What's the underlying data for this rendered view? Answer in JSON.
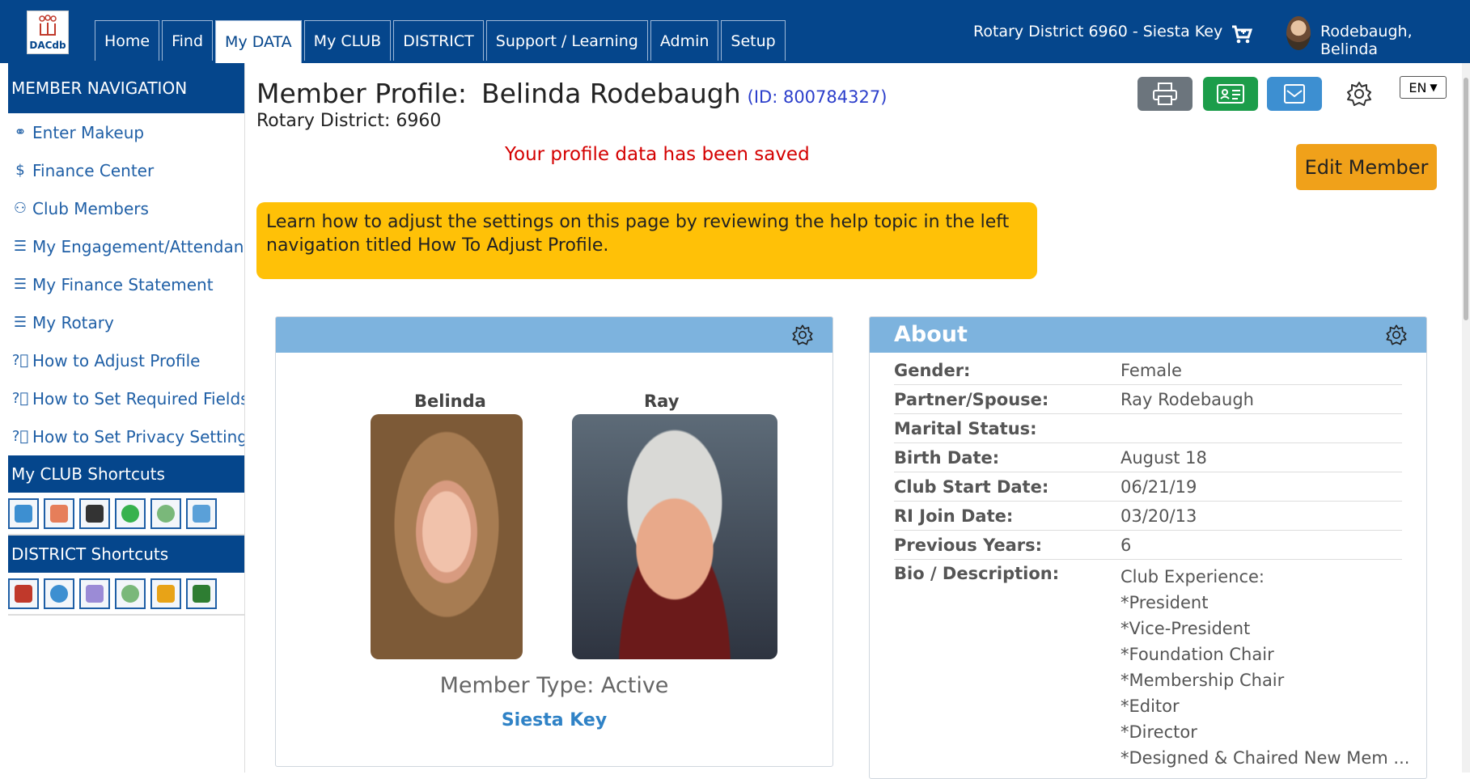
{
  "header": {
    "logo_text": "DACdb",
    "tabs": [
      {
        "label": "Home",
        "active": false
      },
      {
        "label": "Find",
        "active": false
      },
      {
        "label": "My DATA",
        "active": true
      },
      {
        "label": "My CLUB",
        "active": false
      },
      {
        "label": "DISTRICT",
        "active": false
      },
      {
        "label": "Support / Learning",
        "active": false
      },
      {
        "label": "Admin",
        "active": false
      },
      {
        "label": "Setup",
        "active": false
      }
    ],
    "district": "Rotary District 6960 - Siesta Key",
    "user_name": "Rodebaugh, Belinda",
    "colors": {
      "bar": "#05468c"
    }
  },
  "sidebar": {
    "nav_title": "MEMBER NAVIGATION",
    "items": [
      {
        "icon": "handshake-icon",
        "label": "Enter Makeup"
      },
      {
        "icon": "dollar-icon",
        "label": "Finance Center"
      },
      {
        "icon": "group-icon",
        "label": "Club Members"
      },
      {
        "icon": "list-icon",
        "label": "My Engagement/Attendance"
      },
      {
        "icon": "list-icon",
        "label": "My Finance Statement"
      },
      {
        "icon": "list-icon",
        "label": "My Rotary"
      },
      {
        "icon": "help-circle-icon",
        "label": "How to Adjust Profile"
      },
      {
        "icon": "help-circle-icon",
        "label": "How to Set Required Fields"
      },
      {
        "icon": "help-circle-icon",
        "label": "How to Set Privacy Settings"
      }
    ],
    "club_shortcuts_title": "My CLUB Shortcuts",
    "club_shortcuts": [
      "search-icon",
      "members-icon",
      "email-icon",
      "chat-icon",
      "history-icon",
      "chart-icon"
    ],
    "district_shortcuts_title": "DISTRICT Shortcuts",
    "district_shortcuts": [
      "people-icon",
      "search-icon",
      "org-chart-icon",
      "history-icon",
      "run-icon",
      "chip-icon"
    ]
  },
  "profile": {
    "title_prefix": "Member Profile:",
    "name": "Belinda Rodebaugh",
    "id_text": "(ID: 800784327)",
    "district_line": "Rotary District: 6960",
    "saved_message": "Your profile data has been saved",
    "edit_button": "Edit Member",
    "language": "EN",
    "help_text": "Learn how to adjust the settings on this page by reviewing the help topic in the left navigation titled How To Adjust Profile."
  },
  "photos": {
    "member_label": "Belinda",
    "spouse_label": "Ray",
    "member_type": "Member Type: Active",
    "club": "Siesta Key"
  },
  "about": {
    "title": "About",
    "rows": [
      {
        "label": "Gender:",
        "value": "Female"
      },
      {
        "label": "Partner/Spouse:",
        "value": "Ray Rodebaugh"
      },
      {
        "label": "Marital Status:",
        "value": ""
      },
      {
        "label": "Birth Date:",
        "value": "August 18"
      },
      {
        "label": "Club Start Date:",
        "value": "06/21/19"
      },
      {
        "label": "RI Join Date:",
        "value": "03/20/13"
      },
      {
        "label": "Previous Years:",
        "value": "6"
      }
    ],
    "bio_label": "Bio / Description:",
    "bio_lines": [
      "Club Experience:",
      "*President",
      "*Vice-President",
      "*Foundation Chair",
      "*Membership Chair",
      "*Editor",
      "*Director",
      "*Designed & Chaired New Mem ..."
    ]
  }
}
